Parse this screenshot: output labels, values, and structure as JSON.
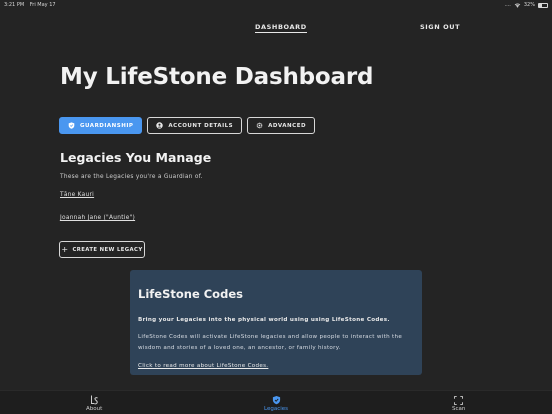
{
  "status_bar": {
    "time": "3:21 PM",
    "date": "Fri May 17",
    "signal": "....",
    "battery": "32%"
  },
  "top_nav": {
    "dashboard": "DASHBOARD",
    "sign_out": "SIGN OUT"
  },
  "page": {
    "title": "My LifeStone Dashboard"
  },
  "tabs": [
    {
      "label": "GUARDIANSHIP",
      "icon": "shield-icon",
      "active": true
    },
    {
      "label": "ACCOUNT DETAILS",
      "icon": "person-icon",
      "active": false
    },
    {
      "label": "ADVANCED",
      "icon": "gear-icon",
      "active": false
    }
  ],
  "legacies": {
    "title": "Legacies You Manage",
    "description": "These are the Legacies you're a Guardian of.",
    "items": [
      "Tāne Kauri",
      "Joannah Jane (\"Auntie\")"
    ],
    "create_button": "CREATE NEW LEGACY"
  },
  "codes": {
    "title": "LifeStone Codes",
    "lead": "Bring your Legacies into the physical world using using LifeStone Codes.",
    "body": "LifeStone Codes will activate LifeStone legacies and allow people to interact with the wisdom and stories of a loved one, an ancestor, or family history.",
    "link": "Click to read more about LifeStone Codes."
  },
  "bottom_nav": [
    {
      "label": "About",
      "icon": "lifestone-logo-icon",
      "active": false
    },
    {
      "label": "Legacies",
      "icon": "shield-icon",
      "active": true
    },
    {
      "label": "Scan",
      "icon": "scan-icon",
      "active": false
    }
  ],
  "colors": {
    "background": "#242424",
    "accent": "#4a97f0",
    "card": "#2f4358"
  }
}
